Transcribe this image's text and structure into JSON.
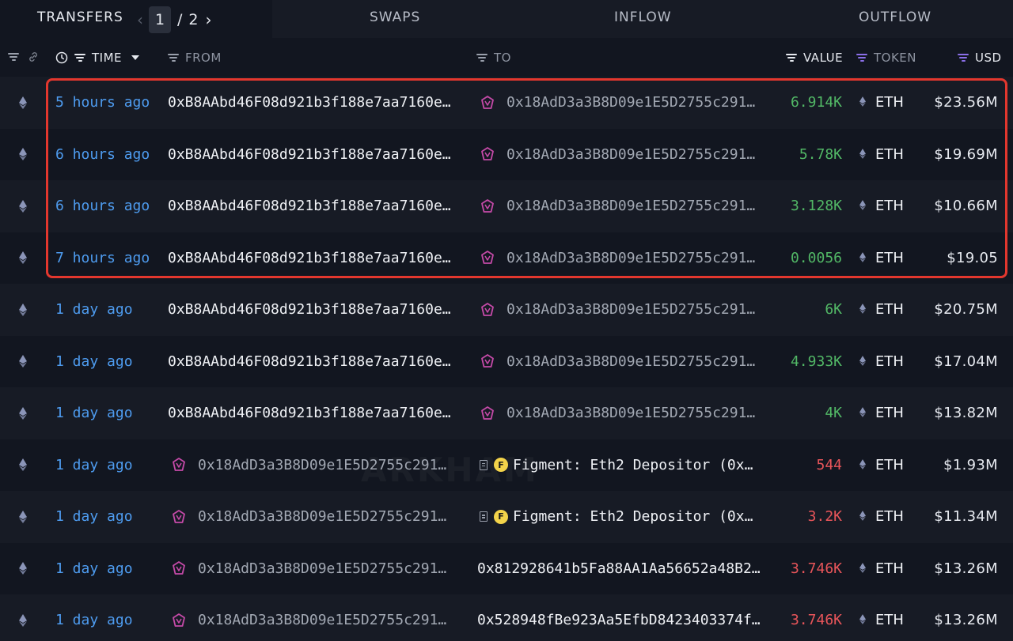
{
  "tabs": {
    "transfers": "TRANSFERS",
    "swaps": "SWAPS",
    "inflow": "INFLOW",
    "outflow": "OUTFLOW",
    "page_current": "1",
    "page_separator": "/",
    "page_total": "2"
  },
  "columns": {
    "time": "TIME",
    "from": "FROM",
    "to": "TO",
    "value": "VALUE",
    "token": "TOKEN",
    "usd": "USD"
  },
  "icons": {
    "chain": "ethereum-icon",
    "entity": "arkham-entity-icon",
    "doc": "contract-icon",
    "figment": "figment-logo-icon"
  },
  "colors": {
    "time_link": "#4e9cf0",
    "value_in": "#52b866",
    "value_out": "#e8555a",
    "highlight": "#e3372e"
  },
  "watermark": "ARKHAM",
  "rows": [
    {
      "time": "5 hours ago",
      "from": "0xB8AAbd46F08d921b3f188e7aa7160e…",
      "to": "0x18AdD3a3B8D09e1E5D2755c291…",
      "value": "6.914K",
      "token": "ETH",
      "usd": "$23.56M"
    },
    {
      "time": "6 hours ago",
      "from": "0xB8AAbd46F08d921b3f188e7aa7160e…",
      "to": "0x18AdD3a3B8D09e1E5D2755c291…",
      "value": "5.78K",
      "token": "ETH",
      "usd": "$19.69M"
    },
    {
      "time": "6 hours ago",
      "from": "0xB8AAbd46F08d921b3f188e7aa7160e…",
      "to": "0x18AdD3a3B8D09e1E5D2755c291…",
      "value": "3.128K",
      "token": "ETH",
      "usd": "$10.66M"
    },
    {
      "time": "7 hours ago",
      "from": "0xB8AAbd46F08d921b3f188e7aa7160e…",
      "to": "0x18AdD3a3B8D09e1E5D2755c291…",
      "value": "0.0056",
      "token": "ETH",
      "usd": "$19.05"
    },
    {
      "time": "1 day ago",
      "from": "0xB8AAbd46F08d921b3f188e7aa7160e…",
      "to": "0x18AdD3a3B8D09e1E5D2755c291…",
      "value": "6K",
      "token": "ETH",
      "usd": "$20.75M"
    },
    {
      "time": "1 day ago",
      "from": "0xB8AAbd46F08d921b3f188e7aa7160e…",
      "to": "0x18AdD3a3B8D09e1E5D2755c291…",
      "value": "4.933K",
      "token": "ETH",
      "usd": "$17.04M"
    },
    {
      "time": "1 day ago",
      "from": "0xB8AAbd46F08d921b3f188e7aa7160e…",
      "to": "0x18AdD3a3B8D09e1E5D2755c291…",
      "value": "4K",
      "token": "ETH",
      "usd": "$13.82M"
    },
    {
      "time": "1 day ago",
      "from": "0x18AdD3a3B8D09e1E5D2755c291…",
      "to": "Figment: Eth2 Depositor (0x…",
      "value": "544",
      "token": "ETH",
      "usd": "$1.93M"
    },
    {
      "time": "1 day ago",
      "from": "0x18AdD3a3B8D09e1E5D2755c291…",
      "to": "Figment: Eth2 Depositor (0x…",
      "value": "3.2K",
      "token": "ETH",
      "usd": "$11.34M"
    },
    {
      "time": "1 day ago",
      "from": "0x18AdD3a3B8D09e1E5D2755c291…",
      "to": "0x812928641b5Fa88AA1Aa56652a48B2…",
      "value": "3.746K",
      "token": "ETH",
      "usd": "$13.26M"
    },
    {
      "time": "1 day ago",
      "from": "0x18AdD3a3B8D09e1E5D2755c291…",
      "to": "0x528948fBe923Aa5EfbD8423403374f…",
      "value": "3.746K",
      "token": "ETH",
      "usd": "$13.26M"
    }
  ]
}
